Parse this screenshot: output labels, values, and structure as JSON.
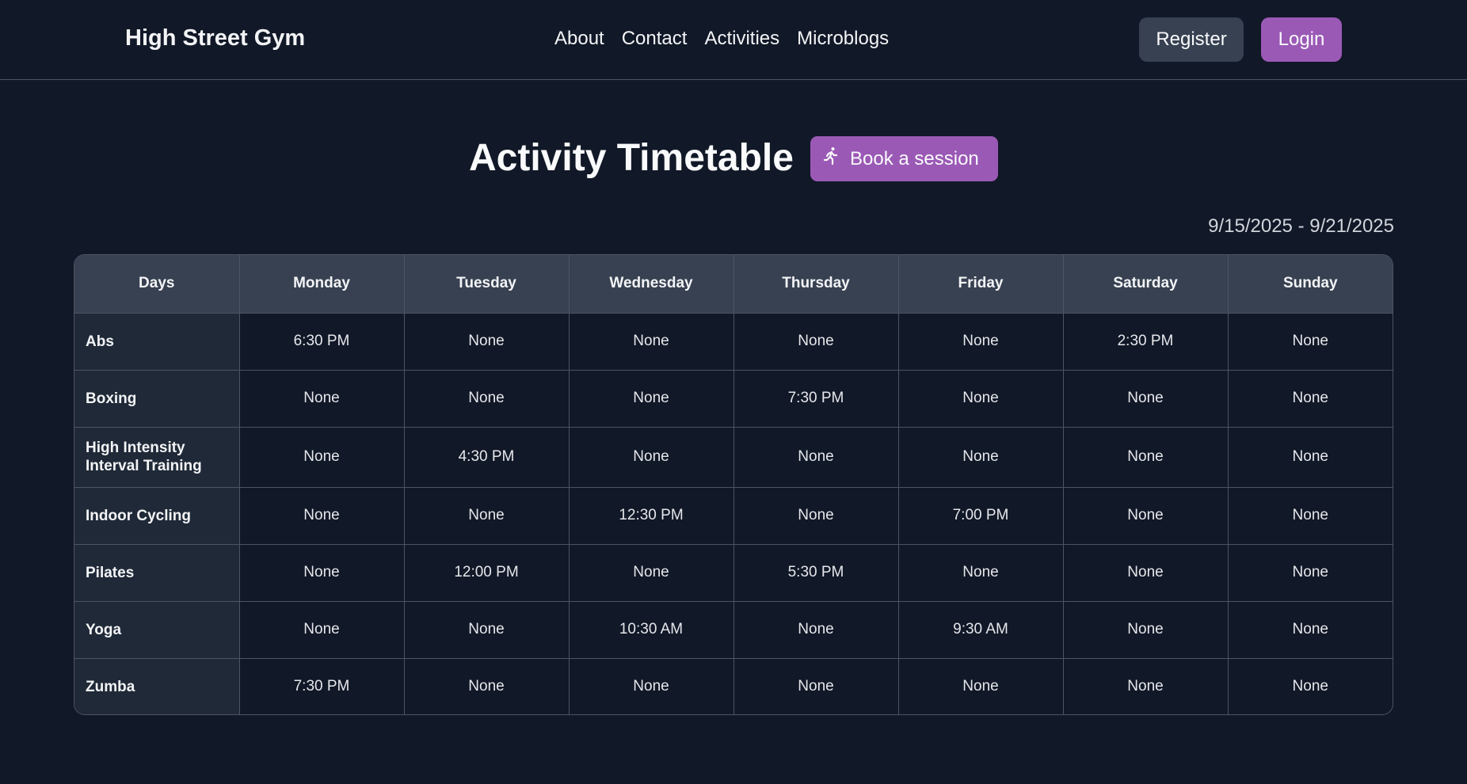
{
  "header": {
    "brand": "High Street Gym",
    "nav": [
      "About",
      "Contact",
      "Activities",
      "Microblogs"
    ],
    "register_label": "Register",
    "login_label": "Login"
  },
  "main": {
    "title": "Activity Timetable",
    "book_label": "Book a session",
    "date_range": "9/15/2025 - 9/21/2025"
  },
  "table": {
    "headers": [
      "Days",
      "Monday",
      "Tuesday",
      "Wednesday",
      "Thursday",
      "Friday",
      "Saturday",
      "Sunday"
    ],
    "rows": [
      {
        "activity": "Abs",
        "times": [
          "6:30 PM",
          "None",
          "None",
          "None",
          "None",
          "2:30 PM",
          "None"
        ]
      },
      {
        "activity": "Boxing",
        "times": [
          "None",
          "None",
          "None",
          "7:30 PM",
          "None",
          "None",
          "None"
        ]
      },
      {
        "activity": "High Intensity Interval Training",
        "times": [
          "None",
          "4:30 PM",
          "None",
          "None",
          "None",
          "None",
          "None"
        ]
      },
      {
        "activity": "Indoor Cycling",
        "times": [
          "None",
          "None",
          "12:30 PM",
          "None",
          "7:00 PM",
          "None",
          "None"
        ]
      },
      {
        "activity": "Pilates",
        "times": [
          "None",
          "12:00 PM",
          "None",
          "5:30 PM",
          "None",
          "None",
          "None"
        ]
      },
      {
        "activity": "Yoga",
        "times": [
          "None",
          "None",
          "10:30 AM",
          "None",
          "9:30 AM",
          "None",
          "None"
        ]
      },
      {
        "activity": "Zumba",
        "times": [
          "7:30 PM",
          "None",
          "None",
          "None",
          "None",
          "None",
          "None"
        ]
      }
    ]
  },
  "colors": {
    "background": "#111827",
    "accent": "#9b59b6",
    "header_row": "#374151",
    "first_column": "#1f2937"
  },
  "icons": {
    "book": "running-person-icon"
  }
}
